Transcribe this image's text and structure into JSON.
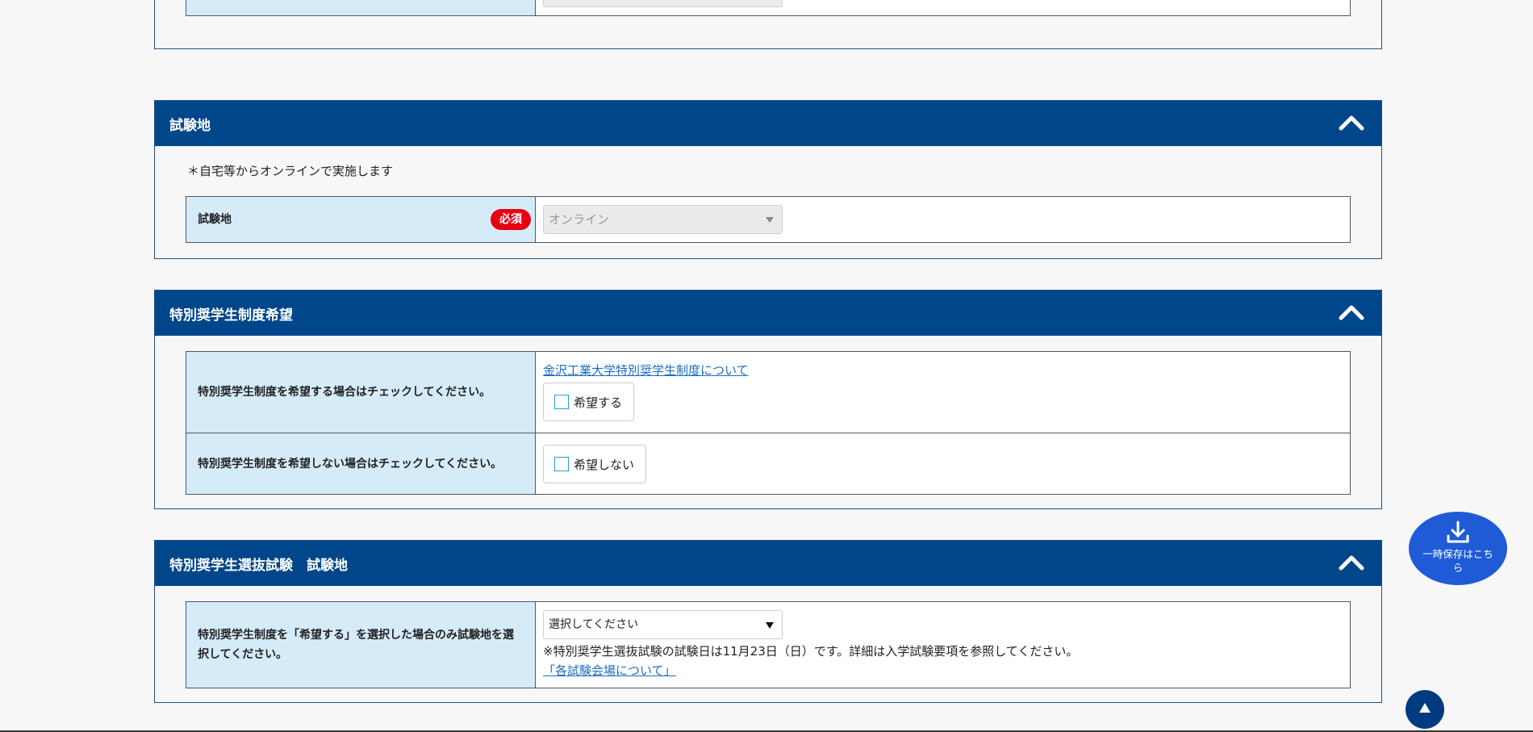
{
  "sections": {
    "venue": {
      "title": "試験地",
      "note": "＊自宅等からオンラインで実施します",
      "label": "試験地",
      "required_badge": "必須",
      "select_value": "オンライン"
    },
    "scholarship": {
      "title": "特別奨学生制度希望",
      "row1_label": "特別奨学生制度を希望する場合はチェックしてください。",
      "link": "金沢工業大学特別奨学生制度について",
      "want_label": "希望する",
      "row2_label": "特別奨学生制度を希望しない場合はチェックしてください。",
      "not_want_label": "希望しない"
    },
    "selection_venue": {
      "title": "特別奨学生選抜試験　試験地",
      "label": "特別奨学生制度を「希望する」を選択した場合のみ試験地を選択してください。",
      "select_value": "選択してください",
      "note": "※特別奨学生選抜試験の試験日は11月23日（日）です。詳細は入学試験要項を参照してください。",
      "link": "「各試験会場について」"
    }
  },
  "save_button": {
    "label": "一時保存はこちら"
  },
  "icons": {
    "collapse": "chevron-up-icon",
    "save": "download-icon",
    "top": "arrow-up-icon"
  },
  "colors": {
    "header": "#00468b",
    "label_bg": "#d5ebf8",
    "required": "#e60012",
    "save_fab": "#1f5bd6",
    "link": "#1b6ec2"
  }
}
